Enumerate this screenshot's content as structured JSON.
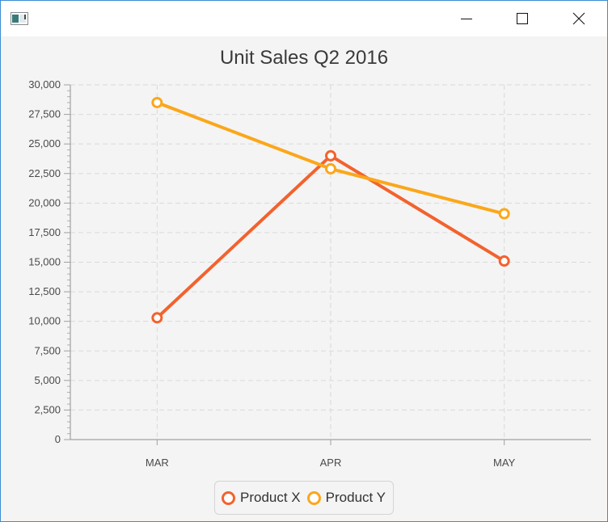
{
  "window": {
    "title": ""
  },
  "chart_data": {
    "type": "line",
    "title": "Unit Sales Q2 2016",
    "xlabel": "",
    "ylabel": "",
    "categories": [
      "MAR",
      "APR",
      "MAY"
    ],
    "ylim": [
      0,
      30000
    ],
    "ytick_step": 2500,
    "ytick_labels": [
      "0",
      "2,500",
      "5,000",
      "7,500",
      "10,000",
      "12,500",
      "15,000",
      "17,500",
      "20,000",
      "22,500",
      "25,000",
      "27,500",
      "30,000"
    ],
    "grid": true,
    "legend_position": "bottom",
    "series": [
      {
        "name": "Product X",
        "color": "#f3622d",
        "values": [
          10300,
          24000,
          15100
        ]
      },
      {
        "name": "Product Y",
        "color": "#fba71b",
        "values": [
          28500,
          22900,
          19100
        ]
      }
    ]
  }
}
